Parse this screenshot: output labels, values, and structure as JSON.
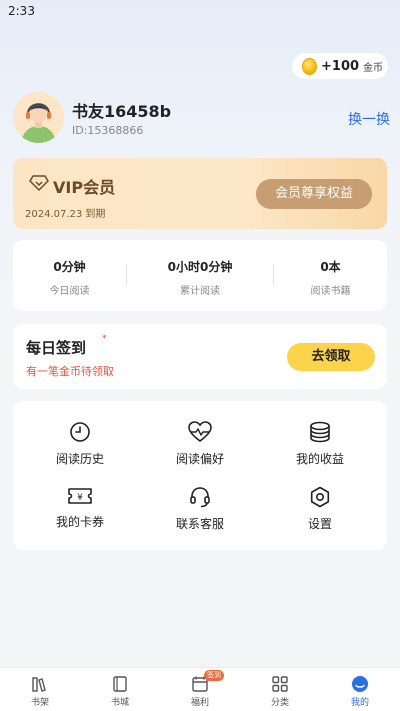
{
  "status_bar": {
    "time": "2:33"
  },
  "coins": {
    "amount": "+100",
    "unit": "金币",
    "icon": "coin-icon"
  },
  "profile": {
    "username": "书友16458b",
    "user_id": "ID:15368866",
    "switch_label": "换一换",
    "avatar_icon": "avatar-headset-icon"
  },
  "vip": {
    "title": "VIP会员",
    "expire": "2024.07.23 到期",
    "button_label": "会员尊享权益"
  },
  "stats": [
    {
      "value": "0分钟",
      "label": "今日阅读"
    },
    {
      "value": "0小时0分钟",
      "label": "累计阅读"
    },
    {
      "value": "0本",
      "label": "阅读书籍"
    }
  ],
  "signin": {
    "title": "每日签到",
    "mark": "*",
    "subtitle": "有一笔金币待领取",
    "button_label": "去领取"
  },
  "menu": [
    {
      "label": "阅读历史",
      "icon": "clock-icon"
    },
    {
      "label": "阅读偏好",
      "icon": "heart-pulse-icon"
    },
    {
      "label": "我的收益",
      "icon": "coin-stack-icon"
    },
    {
      "label": "我的卡券",
      "icon": "ticket-icon"
    },
    {
      "label": "联系客服",
      "icon": "headset-icon"
    },
    {
      "label": "设置",
      "icon": "settings-icon"
    }
  ],
  "tabbar": {
    "items": [
      {
        "label": "书架",
        "icon": "bookshelf-icon"
      },
      {
        "label": "书城",
        "icon": "book-icon"
      },
      {
        "label": "福利",
        "icon": "calendar-icon",
        "badge": "签到"
      },
      {
        "label": "分类",
        "icon": "grid-icon"
      },
      {
        "label": "我的",
        "icon": "profile-icon",
        "active": true
      }
    ]
  },
  "colors": {
    "accent": "#2c6fe0",
    "signin_button": "#fbd44a",
    "vip_button": "#c79d72",
    "warning_text": "#e8553f"
  }
}
